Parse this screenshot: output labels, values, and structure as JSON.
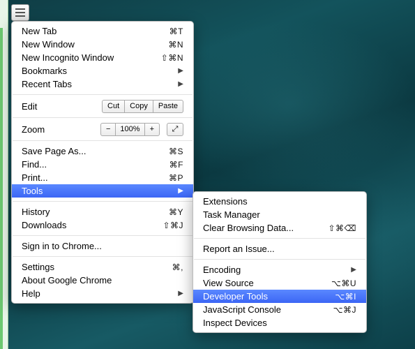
{
  "mainMenu": {
    "newTab": {
      "label": "New Tab",
      "shortcut": "⌘T"
    },
    "newWindow": {
      "label": "New Window",
      "shortcut": "⌘N"
    },
    "newIncognito": {
      "label": "New Incognito Window",
      "shortcut": "⇧⌘N"
    },
    "bookmarks": {
      "label": "Bookmarks"
    },
    "recentTabs": {
      "label": "Recent Tabs"
    },
    "edit": {
      "label": "Edit",
      "cut": "Cut",
      "copy": "Copy",
      "paste": "Paste"
    },
    "zoom": {
      "label": "Zoom",
      "minus": "−",
      "pct": "100%",
      "plus": "+"
    },
    "savePage": {
      "label": "Save Page As...",
      "shortcut": "⌘S"
    },
    "find": {
      "label": "Find...",
      "shortcut": "⌘F"
    },
    "print": {
      "label": "Print...",
      "shortcut": "⌘P"
    },
    "tools": {
      "label": "Tools"
    },
    "history": {
      "label": "History",
      "shortcut": "⌘Y"
    },
    "downloads": {
      "label": "Downloads",
      "shortcut": "⇧⌘J"
    },
    "signIn": {
      "label": "Sign in to Chrome..."
    },
    "settings": {
      "label": "Settings",
      "shortcut": "⌘,"
    },
    "about": {
      "label": "About Google Chrome"
    },
    "help": {
      "label": "Help"
    }
  },
  "subMenu": {
    "extensions": {
      "label": "Extensions"
    },
    "taskManager": {
      "label": "Task Manager"
    },
    "clearData": {
      "label": "Clear Browsing Data...",
      "shortcut": "⇧⌘⌫"
    },
    "reportIssue": {
      "label": "Report an Issue..."
    },
    "encoding": {
      "label": "Encoding"
    },
    "viewSource": {
      "label": "View Source",
      "shortcut": "⌥⌘U"
    },
    "devTools": {
      "label": "Developer Tools",
      "shortcut": "⌥⌘I"
    },
    "jsConsole": {
      "label": "JavaScript Console",
      "shortcut": "⌥⌘J"
    },
    "inspectDevices": {
      "label": "Inspect Devices"
    }
  }
}
